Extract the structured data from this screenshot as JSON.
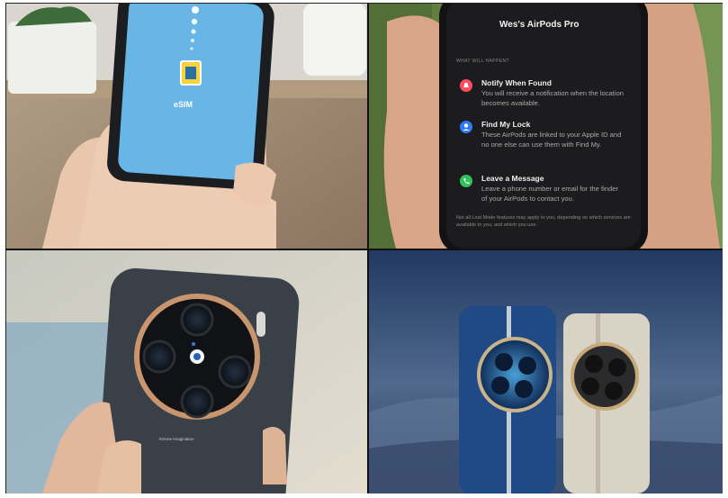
{
  "esim": {
    "label": "eSIM"
  },
  "airpods": {
    "title": "Wes's AirPods Pro",
    "section": "WHAT WILL HAPPEN?",
    "items": [
      {
        "heading": "Notify When Found",
        "body": "You will receive a notification when the location becomes available.",
        "color": "#ff4d5e",
        "icon": "bell-icon"
      },
      {
        "heading": "Find My Lock",
        "body": "These AirPods are linked to your Apple ID and no one else can use them with Find My.",
        "color": "#2f7bf6",
        "icon": "person-icon"
      },
      {
        "heading": "Leave a Message",
        "body": "Leave a phone number or email for the finder of your AirPods to contact you.",
        "color": "#2fc35a",
        "icon": "phone-icon"
      }
    ],
    "footnote": "Not all Lost Mode features may apply to you, depending on which services are available to you, and which you use."
  },
  "camera_phone": {
    "brand_text": "Xtreme Imagination"
  }
}
